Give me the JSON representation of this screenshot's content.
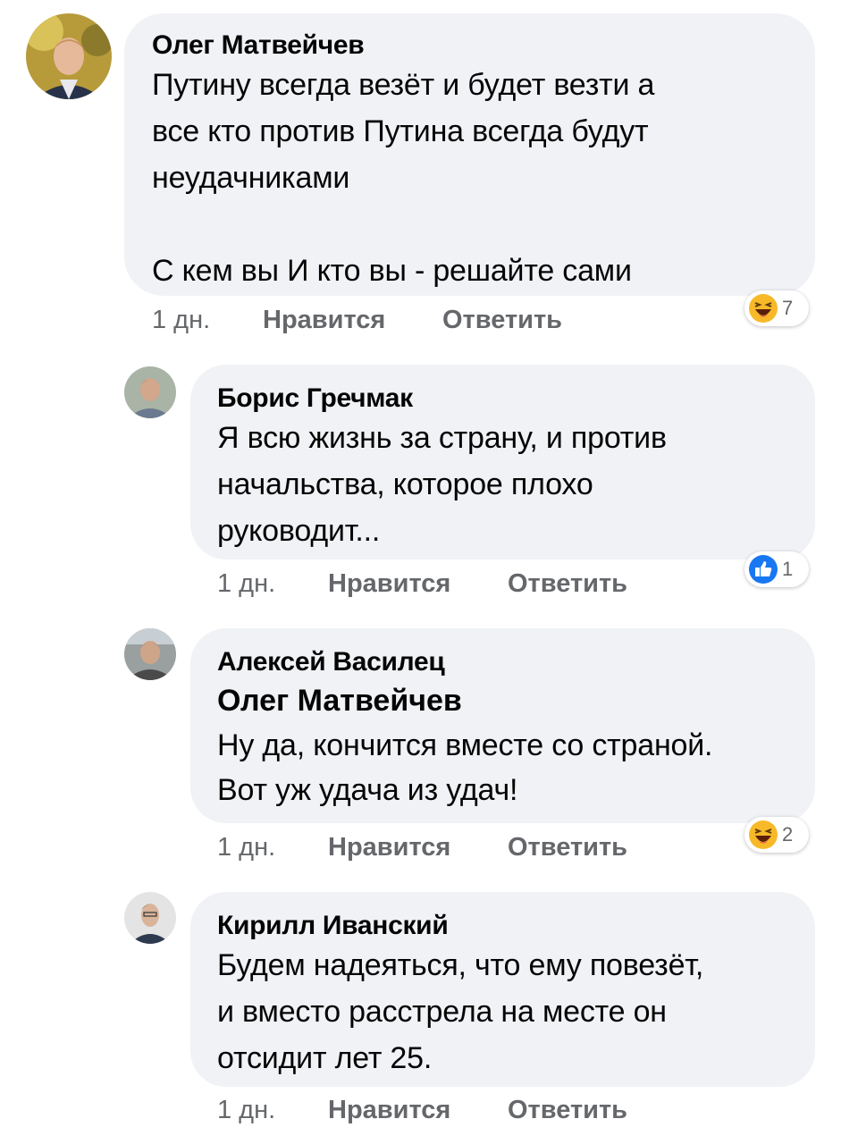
{
  "comments": [
    {
      "author": "Олег Матвейчев",
      "text": "Путину всегда везёт и будет везти а\nвсе кто против Путина всегда будут\nнеудачниками\n\nС кем вы И кто вы - решайте сами",
      "time": "1 дн.",
      "like_label": "Нравится",
      "reply_label": "Ответить",
      "reaction": {
        "type": "haha",
        "count": "7"
      }
    },
    {
      "author": "Борис Гречмак",
      "text": "Я всю жизнь за страну, и против\nначальства, которое плохо\nруководит...",
      "time": "1 дн.",
      "like_label": "Нравится",
      "reply_label": "Ответить",
      "reaction": {
        "type": "like",
        "count": "1"
      }
    },
    {
      "author": "Алексей Василец",
      "mention": "Олег Матвейчев",
      "text": "Ну да, кончится вместе со страной.\nВот уж удача из удач!",
      "time": "1 дн.",
      "like_label": "Нравится",
      "reply_label": "Ответить",
      "reaction": {
        "type": "haha",
        "count": "2"
      }
    },
    {
      "author": "Кирилл Иванский",
      "text": "Будем надеяться, что ему повезёт,\nи вместо расстрела на месте он\nотсидит лет 25.",
      "time": "1 дн.",
      "like_label": "Нравится",
      "reply_label": "Ответить"
    }
  ],
  "colors": {
    "bubble": "#f0f2f5",
    "meta_text": "#65676b",
    "like_blue": "#1877f2",
    "haha_yellow": "#f7b928"
  }
}
